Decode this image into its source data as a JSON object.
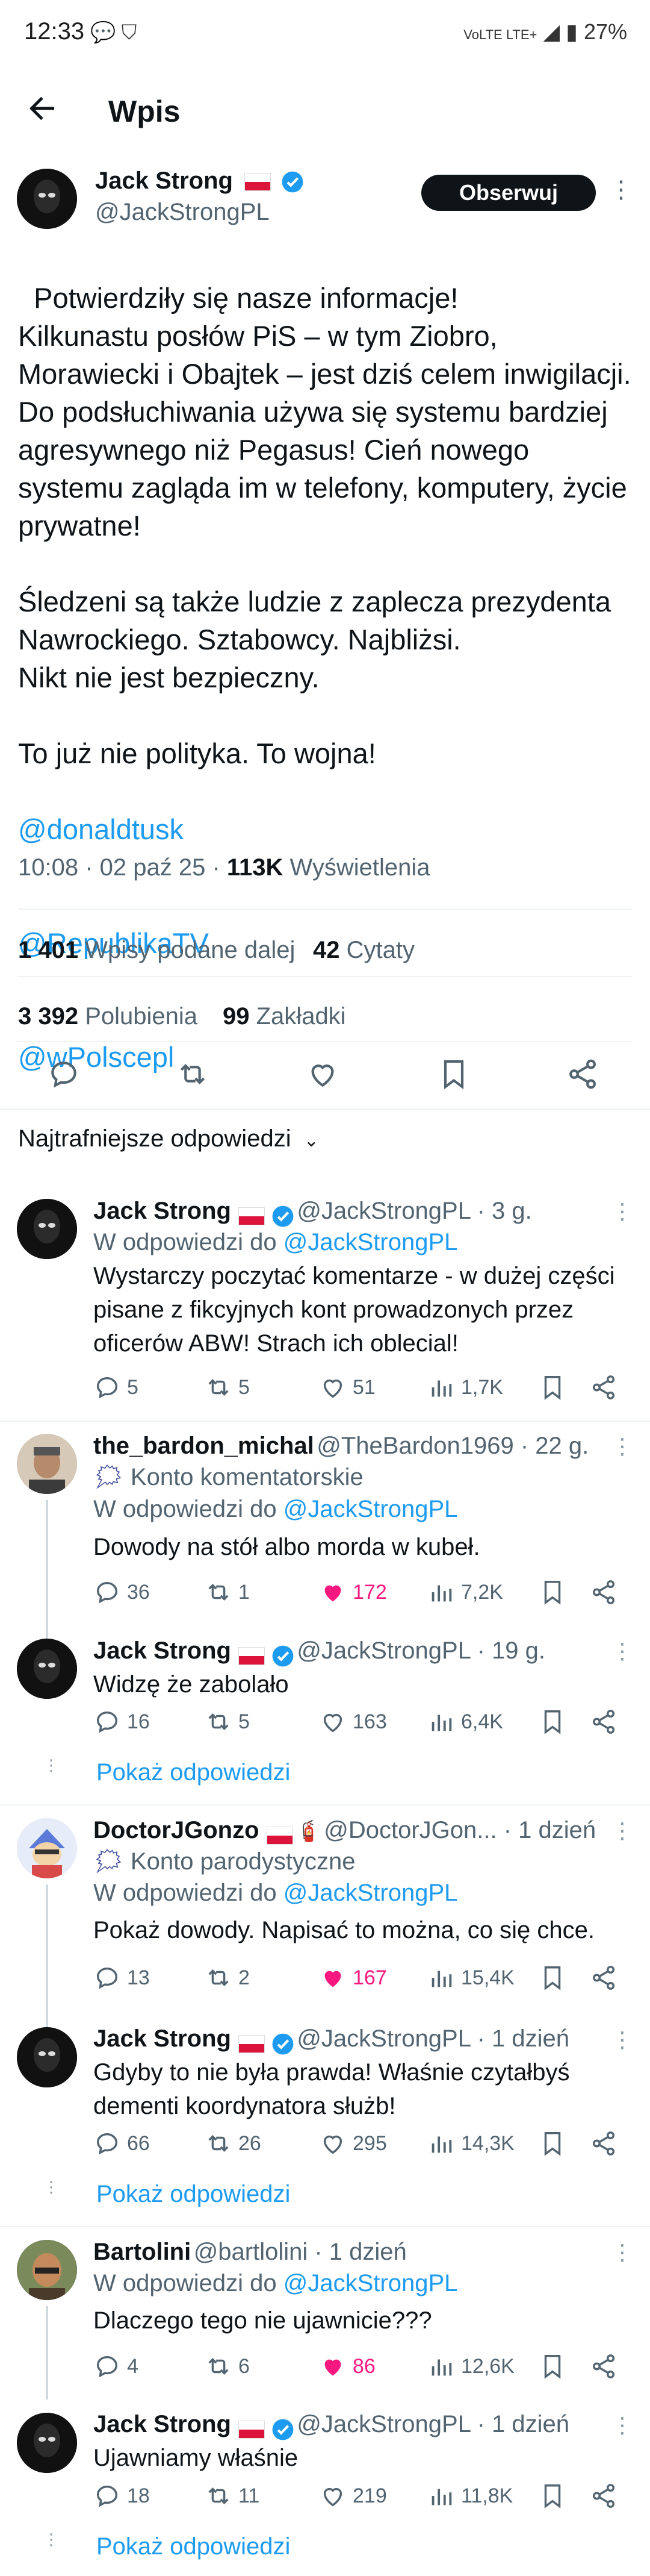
{
  "status_bar": {
    "time": "12:33",
    "network": "VoLTE LTE+",
    "battery": "27%"
  },
  "header": {
    "title": "Wpis"
  },
  "post": {
    "author_name": "Jack Strong",
    "author_handle": "@JackStrongPL",
    "follow_label": "Obserwuj",
    "text": "Potwierdziły się nasze informacje!\nKilkunastu posłów PiS – w tym Ziobro, Morawiecki i Obajtek – jest dziś celem inwigilacji. Do podsłuchiwania używa się systemu bardziej agresywnego niż Pegasus! Cień nowego systemu zagląda im w telefony, komputery, życie prywatne!\n\nŚledzeni są także ludzie z zaplecza prezydenta Nawrockiego. Sztabowcy. Najbliżsi.\nNikt nie jest bezpieczny.\n\nTo już nie polityka. To wojna!",
    "mentions": [
      "@donaldtusk",
      "@RepublikaTV",
      "@wPolscepl"
    ],
    "time": "10:08 · 02 paź 25 · ",
    "views_count": "113K",
    "views_label": " Wyświetlenia",
    "reposts_count": "1 401",
    "reposts_label": "Wpisy podane dalej",
    "quotes_count": "42",
    "quotes_label": "Cytaty",
    "likes_count": "3 392",
    "likes_label": "Polubienia",
    "bookmarks_count": "99",
    "bookmarks_label": "Zakładki"
  },
  "replies_sort": "Najtrafniejsze odpowiedzi",
  "show_replies_label": "Pokaż odpowiedzi",
  "reply_to_prefix": "W odpowiedzi do ",
  "replies": [
    {
      "name": "Jack Strong",
      "handle": "@JackStrongPL · 3 g.",
      "reply_to": "@JackStrongPL",
      "text": "Wystarczy poczytać komentarze - w dużej części pisane z fikcyjnych kont prowadzonych przez oficerów ABW! Strach ich oblecial!",
      "comments": "5",
      "reposts": "5",
      "likes": "51",
      "views": "1,7K"
    },
    {
      "name": "the_bardon_michal",
      "handle": "@TheBardon1969 · 22 g.",
      "badge": "Konto komentatorskie",
      "reply_to": "@JackStrongPL",
      "text": "Dowody na stół albo morda w kubeł.",
      "comments": "36",
      "reposts": "1",
      "likes": "172",
      "views": "7,2K"
    },
    {
      "name": "Jack Strong",
      "handle": "@JackStrongPL · 19 g.",
      "text": "Widzę że zabolało",
      "comments": "16",
      "reposts": "5",
      "likes": "163",
      "views": "6,4K"
    },
    {
      "name": "DoctorJGonzo",
      "handle": "@DoctorJGon...",
      "time": " · 1 dzień",
      "badge": "Konto parodystyczne",
      "reply_to": "@JackStrongPL",
      "text": "Pokaż dowody. Napisać to można, co się chce.",
      "comments": "13",
      "reposts": "2",
      "likes": "167",
      "views": "15,4K"
    },
    {
      "name": "Jack Strong",
      "handle": "@JackStrongPL · 1 dzień",
      "text": "Gdyby to nie była prawda! Właśnie czytałbyś dementi koordynatora służb!",
      "comments": "66",
      "reposts": "26",
      "likes": "295",
      "views": "14,3K"
    },
    {
      "name": "Bartolini",
      "handle": "@bartlolini · 1 dzień",
      "reply_to": "@JackStrongPL",
      "text": "Dlaczego tego nie ujawnicie???",
      "comments": "4",
      "reposts": "6",
      "likes": "86",
      "views": "12,6K"
    },
    {
      "name": "Jack Strong",
      "handle": "@JackStrongPL · 1 dzień",
      "text": "Ujawniamy właśnie",
      "comments": "18",
      "reposts": "11",
      "likes": "219",
      "views": "11,8K"
    }
  ],
  "colors": {
    "accent": "#1d9bf0",
    "liked": "#f91880",
    "text": "#0f1419",
    "muted": "#536471"
  }
}
